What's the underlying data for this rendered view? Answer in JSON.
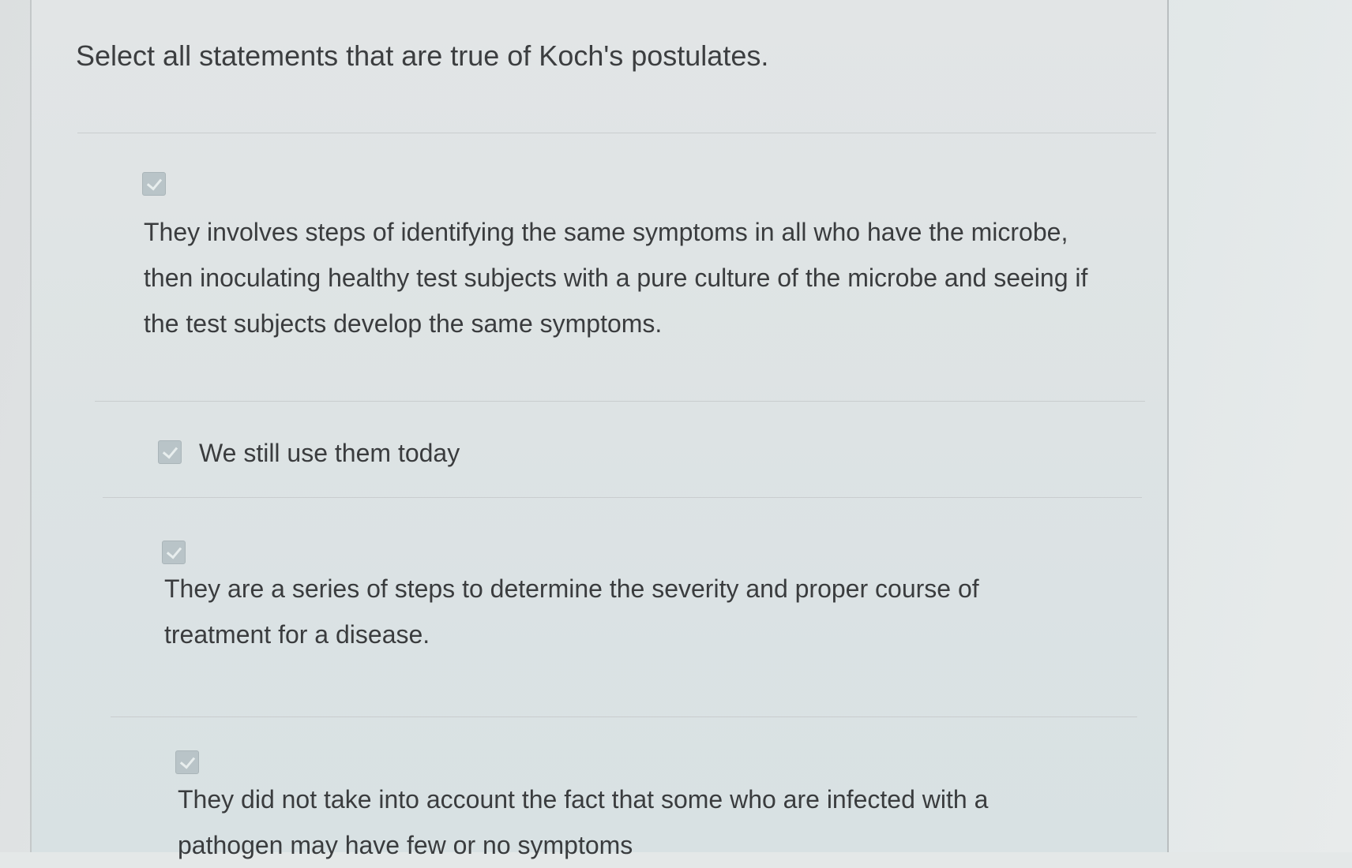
{
  "question": {
    "title": "Select all statements that are true of Koch's postulates."
  },
  "options": [
    {
      "checked": true,
      "text": "They involves steps of identifying the same symptoms in all who have the microbe, then inoculating healthy test subjects with a pure culture of the microbe and seeing if the test subjects develop the same symptoms."
    },
    {
      "checked": true,
      "text": "We still use them today"
    },
    {
      "checked": true,
      "text": "They are a series of steps to determine the severity and proper course of treatment for a disease."
    },
    {
      "checked": true,
      "text": "They did not take into account the fact that some who are infected with a pathogen may have few or no symptoms"
    }
  ],
  "colors": {
    "checkbox_fill": "#b9c4c8",
    "text": "#3a3c3e",
    "title": "#3c3e40"
  }
}
